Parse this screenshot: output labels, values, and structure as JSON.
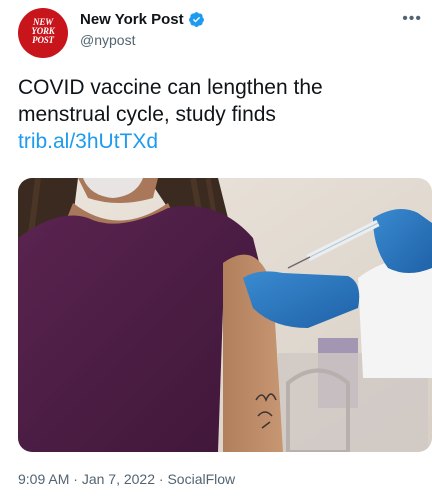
{
  "author": {
    "display_name": "New York Post",
    "handle": "@nypost",
    "verified": true,
    "avatar_logo_lines": [
      "NEW",
      "YORK",
      "POST"
    ]
  },
  "tweet": {
    "text_line1": "COVID vaccine can lengthen the",
    "text_line2": "menstrual cycle, study finds",
    "link": "trib.al/3hUtTXd"
  },
  "meta": {
    "time": "9:09 AM",
    "separator": " · ",
    "date": "Jan 7, 2022",
    "source": "SocialFlow"
  },
  "colors": {
    "brand_red": "#c8141b",
    "link_blue": "#1d9bf0",
    "verified_blue": "#1d9bf0",
    "text_primary": "#0f1419",
    "text_secondary": "#536471"
  },
  "icons": {
    "verified": "verified-badge-icon",
    "more": "more-options-icon"
  }
}
